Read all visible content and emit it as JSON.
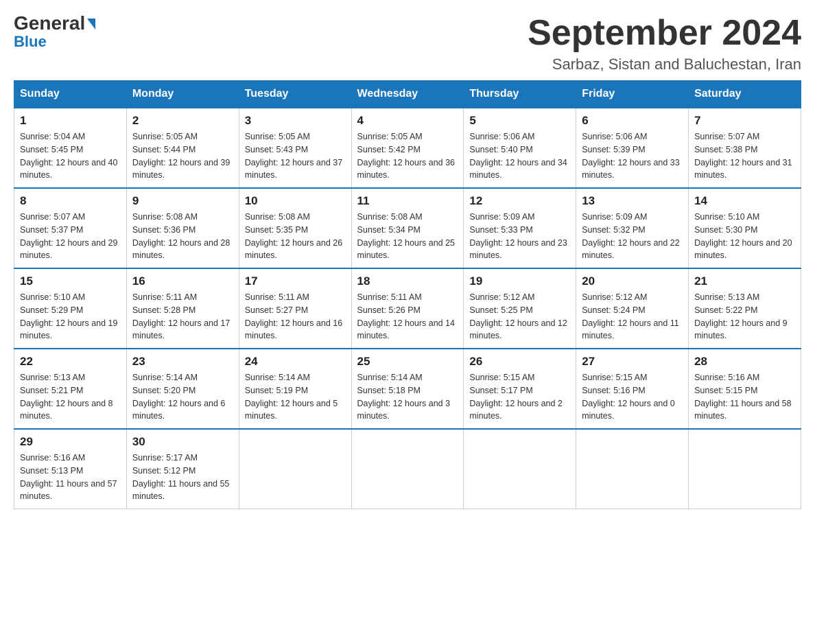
{
  "header": {
    "logo_general": "General",
    "logo_blue": "Blue",
    "month_title": "September 2024",
    "subtitle": "Sarbaz, Sistan and Baluchestan, Iran"
  },
  "weekdays": [
    "Sunday",
    "Monday",
    "Tuesday",
    "Wednesday",
    "Thursday",
    "Friday",
    "Saturday"
  ],
  "weeks": [
    [
      {
        "day": "1",
        "sunrise": "5:04 AM",
        "sunset": "5:45 PM",
        "daylight": "12 hours and 40 minutes."
      },
      {
        "day": "2",
        "sunrise": "5:05 AM",
        "sunset": "5:44 PM",
        "daylight": "12 hours and 39 minutes."
      },
      {
        "day": "3",
        "sunrise": "5:05 AM",
        "sunset": "5:43 PM",
        "daylight": "12 hours and 37 minutes."
      },
      {
        "day": "4",
        "sunrise": "5:05 AM",
        "sunset": "5:42 PM",
        "daylight": "12 hours and 36 minutes."
      },
      {
        "day": "5",
        "sunrise": "5:06 AM",
        "sunset": "5:40 PM",
        "daylight": "12 hours and 34 minutes."
      },
      {
        "day": "6",
        "sunrise": "5:06 AM",
        "sunset": "5:39 PM",
        "daylight": "12 hours and 33 minutes."
      },
      {
        "day": "7",
        "sunrise": "5:07 AM",
        "sunset": "5:38 PM",
        "daylight": "12 hours and 31 minutes."
      }
    ],
    [
      {
        "day": "8",
        "sunrise": "5:07 AM",
        "sunset": "5:37 PM",
        "daylight": "12 hours and 29 minutes."
      },
      {
        "day": "9",
        "sunrise": "5:08 AM",
        "sunset": "5:36 PM",
        "daylight": "12 hours and 28 minutes."
      },
      {
        "day": "10",
        "sunrise": "5:08 AM",
        "sunset": "5:35 PM",
        "daylight": "12 hours and 26 minutes."
      },
      {
        "day": "11",
        "sunrise": "5:08 AM",
        "sunset": "5:34 PM",
        "daylight": "12 hours and 25 minutes."
      },
      {
        "day": "12",
        "sunrise": "5:09 AM",
        "sunset": "5:33 PM",
        "daylight": "12 hours and 23 minutes."
      },
      {
        "day": "13",
        "sunrise": "5:09 AM",
        "sunset": "5:32 PM",
        "daylight": "12 hours and 22 minutes."
      },
      {
        "day": "14",
        "sunrise": "5:10 AM",
        "sunset": "5:30 PM",
        "daylight": "12 hours and 20 minutes."
      }
    ],
    [
      {
        "day": "15",
        "sunrise": "5:10 AM",
        "sunset": "5:29 PM",
        "daylight": "12 hours and 19 minutes."
      },
      {
        "day": "16",
        "sunrise": "5:11 AM",
        "sunset": "5:28 PM",
        "daylight": "12 hours and 17 minutes."
      },
      {
        "day": "17",
        "sunrise": "5:11 AM",
        "sunset": "5:27 PM",
        "daylight": "12 hours and 16 minutes."
      },
      {
        "day": "18",
        "sunrise": "5:11 AM",
        "sunset": "5:26 PM",
        "daylight": "12 hours and 14 minutes."
      },
      {
        "day": "19",
        "sunrise": "5:12 AM",
        "sunset": "5:25 PM",
        "daylight": "12 hours and 12 minutes."
      },
      {
        "day": "20",
        "sunrise": "5:12 AM",
        "sunset": "5:24 PM",
        "daylight": "12 hours and 11 minutes."
      },
      {
        "day": "21",
        "sunrise": "5:13 AM",
        "sunset": "5:22 PM",
        "daylight": "12 hours and 9 minutes."
      }
    ],
    [
      {
        "day": "22",
        "sunrise": "5:13 AM",
        "sunset": "5:21 PM",
        "daylight": "12 hours and 8 minutes."
      },
      {
        "day": "23",
        "sunrise": "5:14 AM",
        "sunset": "5:20 PM",
        "daylight": "12 hours and 6 minutes."
      },
      {
        "day": "24",
        "sunrise": "5:14 AM",
        "sunset": "5:19 PM",
        "daylight": "12 hours and 5 minutes."
      },
      {
        "day": "25",
        "sunrise": "5:14 AM",
        "sunset": "5:18 PM",
        "daylight": "12 hours and 3 minutes."
      },
      {
        "day": "26",
        "sunrise": "5:15 AM",
        "sunset": "5:17 PM",
        "daylight": "12 hours and 2 minutes."
      },
      {
        "day": "27",
        "sunrise": "5:15 AM",
        "sunset": "5:16 PM",
        "daylight": "12 hours and 0 minutes."
      },
      {
        "day": "28",
        "sunrise": "5:16 AM",
        "sunset": "5:15 PM",
        "daylight": "11 hours and 58 minutes."
      }
    ],
    [
      {
        "day": "29",
        "sunrise": "5:16 AM",
        "sunset": "5:13 PM",
        "daylight": "11 hours and 57 minutes."
      },
      {
        "day": "30",
        "sunrise": "5:17 AM",
        "sunset": "5:12 PM",
        "daylight": "11 hours and 55 minutes."
      },
      null,
      null,
      null,
      null,
      null
    ]
  ]
}
